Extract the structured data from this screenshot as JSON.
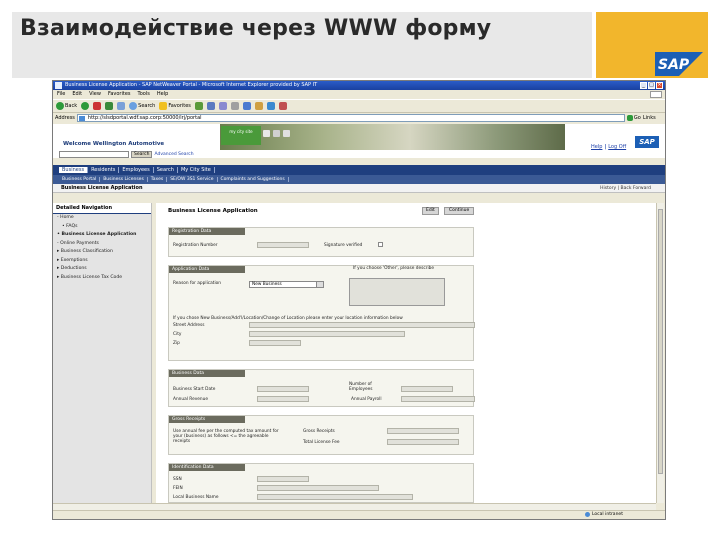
{
  "slide": {
    "title": "Взаимодействие через WWW форму",
    "logo_text": "SAP",
    "colors": {
      "accent": "#f2b62c",
      "title_bar": "#e8e8e8",
      "logo_blue": "#1c5fb5"
    }
  },
  "browser": {
    "window_title": "Business License Application - SAP NetWeaver Portal - Microsoft Internet Explorer provided by SAP IT",
    "menu": [
      "File",
      "Edit",
      "View",
      "Favorites",
      "Tools",
      "Help"
    ],
    "toolbar": {
      "back": "Back",
      "search": "Search",
      "favorites": "Favorites"
    },
    "address_label": "Address",
    "address_value": "http://slsdportal.wdf.sap.corp:50000/irj/portal",
    "go_label": "Go",
    "links_label": "Links",
    "status_zone": "Local intranet"
  },
  "portal": {
    "welcome": "Welcome Wellington Automotive",
    "banner_text": "my city site",
    "help": "Help",
    "separator": "|",
    "logoff": "Log Off",
    "search_button": "Search",
    "advanced_search": "Advanced Search",
    "top_nav": [
      "Business",
      "Residents",
      "Employees",
      "Search",
      "My City Site"
    ],
    "sub_nav": [
      "Business Portal",
      "Business Licenses",
      "Taxes",
      "SE/OW 3S1 Service",
      "Complaints and Suggestions"
    ],
    "page_name": "Business License Application",
    "history": "History",
    "back": "Back",
    "forward": "Forward"
  },
  "detail_nav": {
    "title": "Detailed Navigation",
    "items": [
      {
        "label": "Home",
        "bold": false,
        "indent": false
      },
      {
        "label": "FAQs",
        "bold": false,
        "indent": true
      },
      {
        "label": "Business License Application",
        "bold": true,
        "indent": false
      },
      {
        "label": "Online Payments",
        "bold": false,
        "indent": false
      },
      {
        "label": "Business Classification",
        "bold": false,
        "indent": false
      },
      {
        "label": "Exemptions",
        "bold": false,
        "indent": false
      },
      {
        "label": "Deductions",
        "bold": false,
        "indent": false
      },
      {
        "label": "Business License Tax Code",
        "bold": false,
        "indent": false
      }
    ]
  },
  "form": {
    "title": "Business License Application",
    "edit": "Edit",
    "continue": "Continue",
    "registration": {
      "header": "Registration Data",
      "reg_number_label": "Registration Number",
      "signature_label": "Signature verified"
    },
    "application": {
      "header": "Application Data",
      "reason_label": "Reason for application",
      "reason_value": "New Business",
      "other_label": "If you choose 'Other', please describe",
      "note": "If you chose New Business/Add'l/Location/Change of Location please enter your location information below",
      "street_label": "Street Address",
      "city_label": "City",
      "zip_label": "Zip"
    },
    "business": {
      "header": "Business Data",
      "start_date_label": "Business Start Date",
      "employees_label": "Number of Employees",
      "revenue_label": "Annual Revenue",
      "payroll_label": "Annual Payroll"
    },
    "gross": {
      "header": "Gross Receipts",
      "note": "Use annual fee per the computed tax amount for your (business) as follows <= the agreeable receipts",
      "gross_label": "Gross Receipts",
      "total_fee_label": "Total License Fee"
    },
    "ownership": {
      "header": "Identification Data",
      "ssn_label": "SSN",
      "fein_label": "FEIN",
      "local_label": "Local Business Name"
    }
  }
}
